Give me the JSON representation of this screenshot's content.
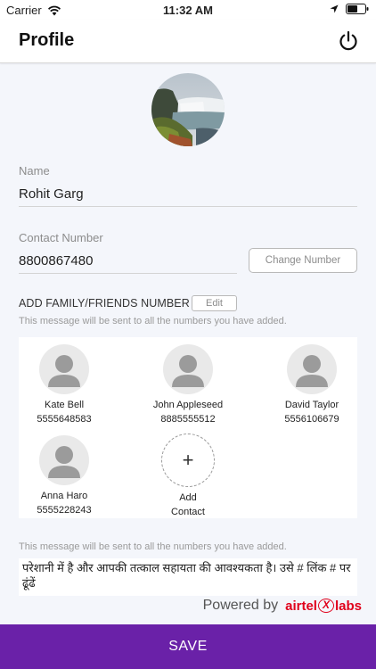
{
  "status_bar": {
    "carrier": "Carrier",
    "time": "11:32 AM"
  },
  "header": {
    "title": "Profile",
    "power_icon": "power-icon"
  },
  "profile": {
    "name_label": "Name",
    "name_value": "Rohit Garg",
    "contact_label": "Contact Number",
    "contact_value": "8800867480",
    "change_number_label": "Change Number"
  },
  "family": {
    "header": "ADD FAMILY/FRIENDS NUMBER",
    "edit_label": "Edit",
    "hint": "This message will be sent to all the numbers you have added.",
    "contacts": [
      {
        "name": "Kate Bell",
        "number": "5555648583"
      },
      {
        "name": "John Appleseed",
        "number": "8885555512"
      },
      {
        "name": "David Taylor",
        "number": "5556106679"
      },
      {
        "name": "Anna Haro",
        "number": "5555228243"
      }
    ],
    "add_contact_line1": "Add",
    "add_contact_line2": "Contact"
  },
  "message": {
    "hint": "This message will be sent to all the numbers you have added.",
    "text": "परेशानी में है और आपकी तत्काल सहायता की आवश्यकता है। उसे # लिंक # पर ढूंढें"
  },
  "footer": {
    "powered_by": "Powered by",
    "brand_left": "airtel",
    "brand_mark": "X",
    "brand_right": "labs",
    "save_label": "SAVE"
  },
  "colors": {
    "save_bar": "#6a21a8",
    "brand": "#e0001b"
  }
}
